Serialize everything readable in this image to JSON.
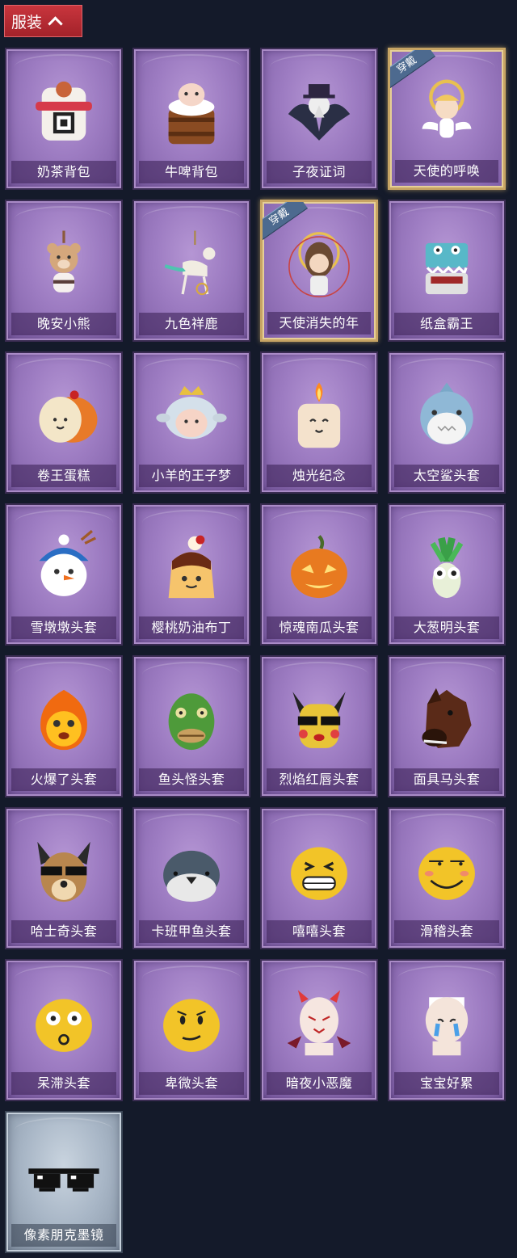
{
  "header": {
    "title": "服装"
  },
  "items": [
    {
      "label": "奶茶背包",
      "icon": "milk-tea-backpack-icon",
      "worn": false
    },
    {
      "label": "牛啤背包",
      "icon": "cow-beer-backpack-icon",
      "worn": false
    },
    {
      "label": "子夜证词",
      "icon": "midnight-testimony-icon",
      "worn": false
    },
    {
      "label": "天使的呼唤",
      "icon": "angel-call-icon",
      "worn": true
    },
    {
      "label": "晚安小熊",
      "icon": "goodnight-bear-icon",
      "worn": false
    },
    {
      "label": "九色祥鹿",
      "icon": "nine-color-deer-icon",
      "worn": false
    },
    {
      "label": "天使消失的年",
      "icon": "angel-vanished-icon",
      "worn": true
    },
    {
      "label": "纸盒霸王",
      "icon": "cardboard-dino-icon",
      "worn": false
    },
    {
      "label": "卷王蛋糕",
      "icon": "roll-cake-icon",
      "worn": false
    },
    {
      "label": "小羊的王子梦",
      "icon": "sheep-prince-icon",
      "worn": false
    },
    {
      "label": "烛光纪念",
      "icon": "candle-icon",
      "worn": false
    },
    {
      "label": "太空鲨头套",
      "icon": "space-shark-icon",
      "worn": false
    },
    {
      "label": "雪墩墩头套",
      "icon": "snowman-icon",
      "worn": false
    },
    {
      "label": "樱桃奶油布丁",
      "icon": "cherry-pudding-icon",
      "worn": false
    },
    {
      "label": "惊魂南瓜头套",
      "icon": "pumpkin-icon",
      "worn": false
    },
    {
      "label": "大葱明头套",
      "icon": "scallion-icon",
      "worn": false
    },
    {
      "label": "火爆了头套",
      "icon": "fire-head-icon",
      "worn": false
    },
    {
      "label": "鱼头怪头套",
      "icon": "fish-monster-icon",
      "worn": false
    },
    {
      "label": "烈焰红唇头套",
      "icon": "yellow-mouse-icon",
      "worn": false
    },
    {
      "label": "面具马头套",
      "icon": "horse-mask-icon",
      "worn": false
    },
    {
      "label": "哈士奇头套",
      "icon": "husky-icon",
      "worn": false
    },
    {
      "label": "卡班甲鱼头套",
      "icon": "whale-head-icon",
      "worn": false
    },
    {
      "label": "嘻嘻头套",
      "icon": "grin-emoji-icon",
      "worn": false
    },
    {
      "label": "滑稽头套",
      "icon": "funny-emoji-icon",
      "worn": false
    },
    {
      "label": "呆滞头套",
      "icon": "dazed-emoji-icon",
      "worn": false
    },
    {
      "label": "卑微头套",
      "icon": "humble-emoji-icon",
      "worn": false
    },
    {
      "label": "暗夜小恶魔",
      "icon": "little-devil-icon",
      "worn": false
    },
    {
      "label": "宝宝好累",
      "icon": "tired-baby-icon",
      "worn": false
    },
    {
      "label": "像素朋克墨镜",
      "icon": "pixel-sunglasses-icon",
      "worn": false,
      "silver": true
    }
  ],
  "badge_text": "穿戴",
  "colors": {
    "background": "#141a2a",
    "header": "#b22a33",
    "card_purple": "#9d7cc2",
    "card_silver": "#a8b6c6",
    "worn_border": "#c7a464"
  }
}
